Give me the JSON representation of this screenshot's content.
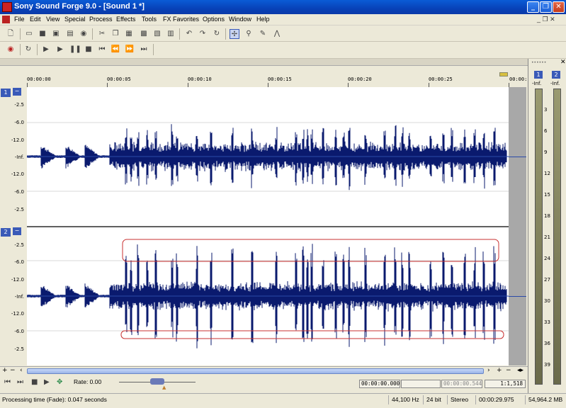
{
  "window": {
    "title": "Sony Sound Forge 9.0 - [Sound 1 *]",
    "buttons": {
      "minimize": "_",
      "maximize": "❐",
      "close": "✕"
    }
  },
  "menu": {
    "items": [
      "File",
      "Edit",
      "View",
      "Special",
      "Process",
      "Effects",
      "Tools",
      "FX Favorites",
      "Options",
      "Window",
      "Help"
    ],
    "mdi_controls": "_ ❐ ✕"
  },
  "timeline": {
    "labels": [
      "00:00:00",
      "00:00:05",
      "00:00:10",
      "00:00:15",
      "00:00:20",
      "00:00:25",
      "00:00:"
    ]
  },
  "channels": [
    {
      "number": "1",
      "db_labels": [
        "-2.5",
        "-6.0",
        "-12.0",
        "-Inf.",
        "-12.0",
        "-6.0",
        "-2.5"
      ]
    },
    {
      "number": "2",
      "db_labels": [
        "-2.5",
        "-6.0",
        "-12.0",
        "-Inf.",
        "-12.0",
        "-6.0",
        "-2.5"
      ]
    }
  ],
  "transport": {
    "rate_label": "Rate: 0.00",
    "selection_start": "00:00:00.000",
    "selection_end": "",
    "selection_length": "00:00:00.544",
    "zoom_ratio": "1:1,518"
  },
  "status": {
    "message": "Processing time (Fade): 0.047 seconds",
    "sample_rate": "44,100 Hz",
    "bit_depth": "24 bit",
    "channels": "Stereo",
    "length": "00:00:29.975",
    "free_space": "54,964.2 MB"
  },
  "meters": {
    "channel_labels": [
      "1",
      "2"
    ],
    "peak_values": [
      "-Inf.",
      "-Inf."
    ],
    "scale": [
      "3",
      "6",
      "9",
      "12",
      "15",
      "18",
      "21",
      "24",
      "27",
      "30",
      "33",
      "36",
      "39"
    ]
  },
  "colors": {
    "waveform": "#0a1a6e",
    "selection_outline": "#c83030",
    "titlebar": "#0a4fc8"
  }
}
